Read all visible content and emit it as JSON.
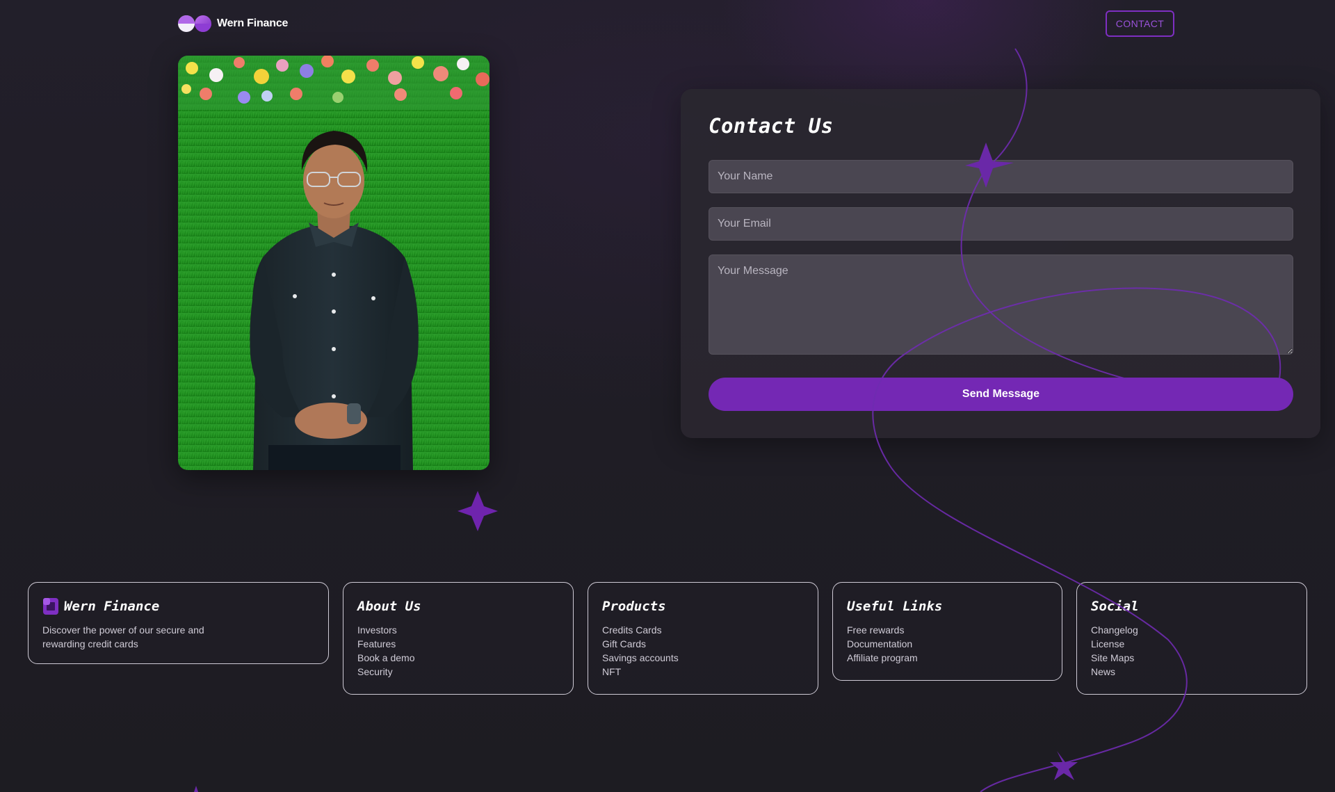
{
  "brand": {
    "name": "Wern Finance",
    "logo_icon": "wern-finance-logo-icon"
  },
  "header": {
    "contact_label": "CONTACT"
  },
  "profile_photo": {
    "subject": "person-portrait-photo"
  },
  "contact": {
    "title": "Contact Us",
    "name_placeholder": "Your Name",
    "email_placeholder": "Your Email",
    "message_placeholder": "Your Message",
    "submit_label": "Send Message"
  },
  "footer": {
    "brand_card": {
      "title": "Wern Finance",
      "description": "Discover the power of our secure and rewarding credit cards",
      "icon": "wern-square-icon"
    },
    "columns": [
      {
        "title": "About Us",
        "items": [
          "Investors",
          "Features",
          "Book a demo",
          "Security"
        ]
      },
      {
        "title": "Products",
        "items": [
          "Credits Cards",
          "Gift Cards",
          "Savings accounts",
          "NFT"
        ]
      },
      {
        "title": "Useful Links",
        "items": [
          "Free rewards",
          "Documentation",
          "Affiliate program"
        ]
      },
      {
        "title": "Social",
        "items": [
          "Changelog",
          "License",
          "Site Maps",
          "News"
        ]
      }
    ]
  },
  "colors": {
    "accent": "#7428b4",
    "accent_light": "#9a52da",
    "background": "#1f1e25",
    "card": "#2a2730",
    "field": "#4a4651"
  }
}
